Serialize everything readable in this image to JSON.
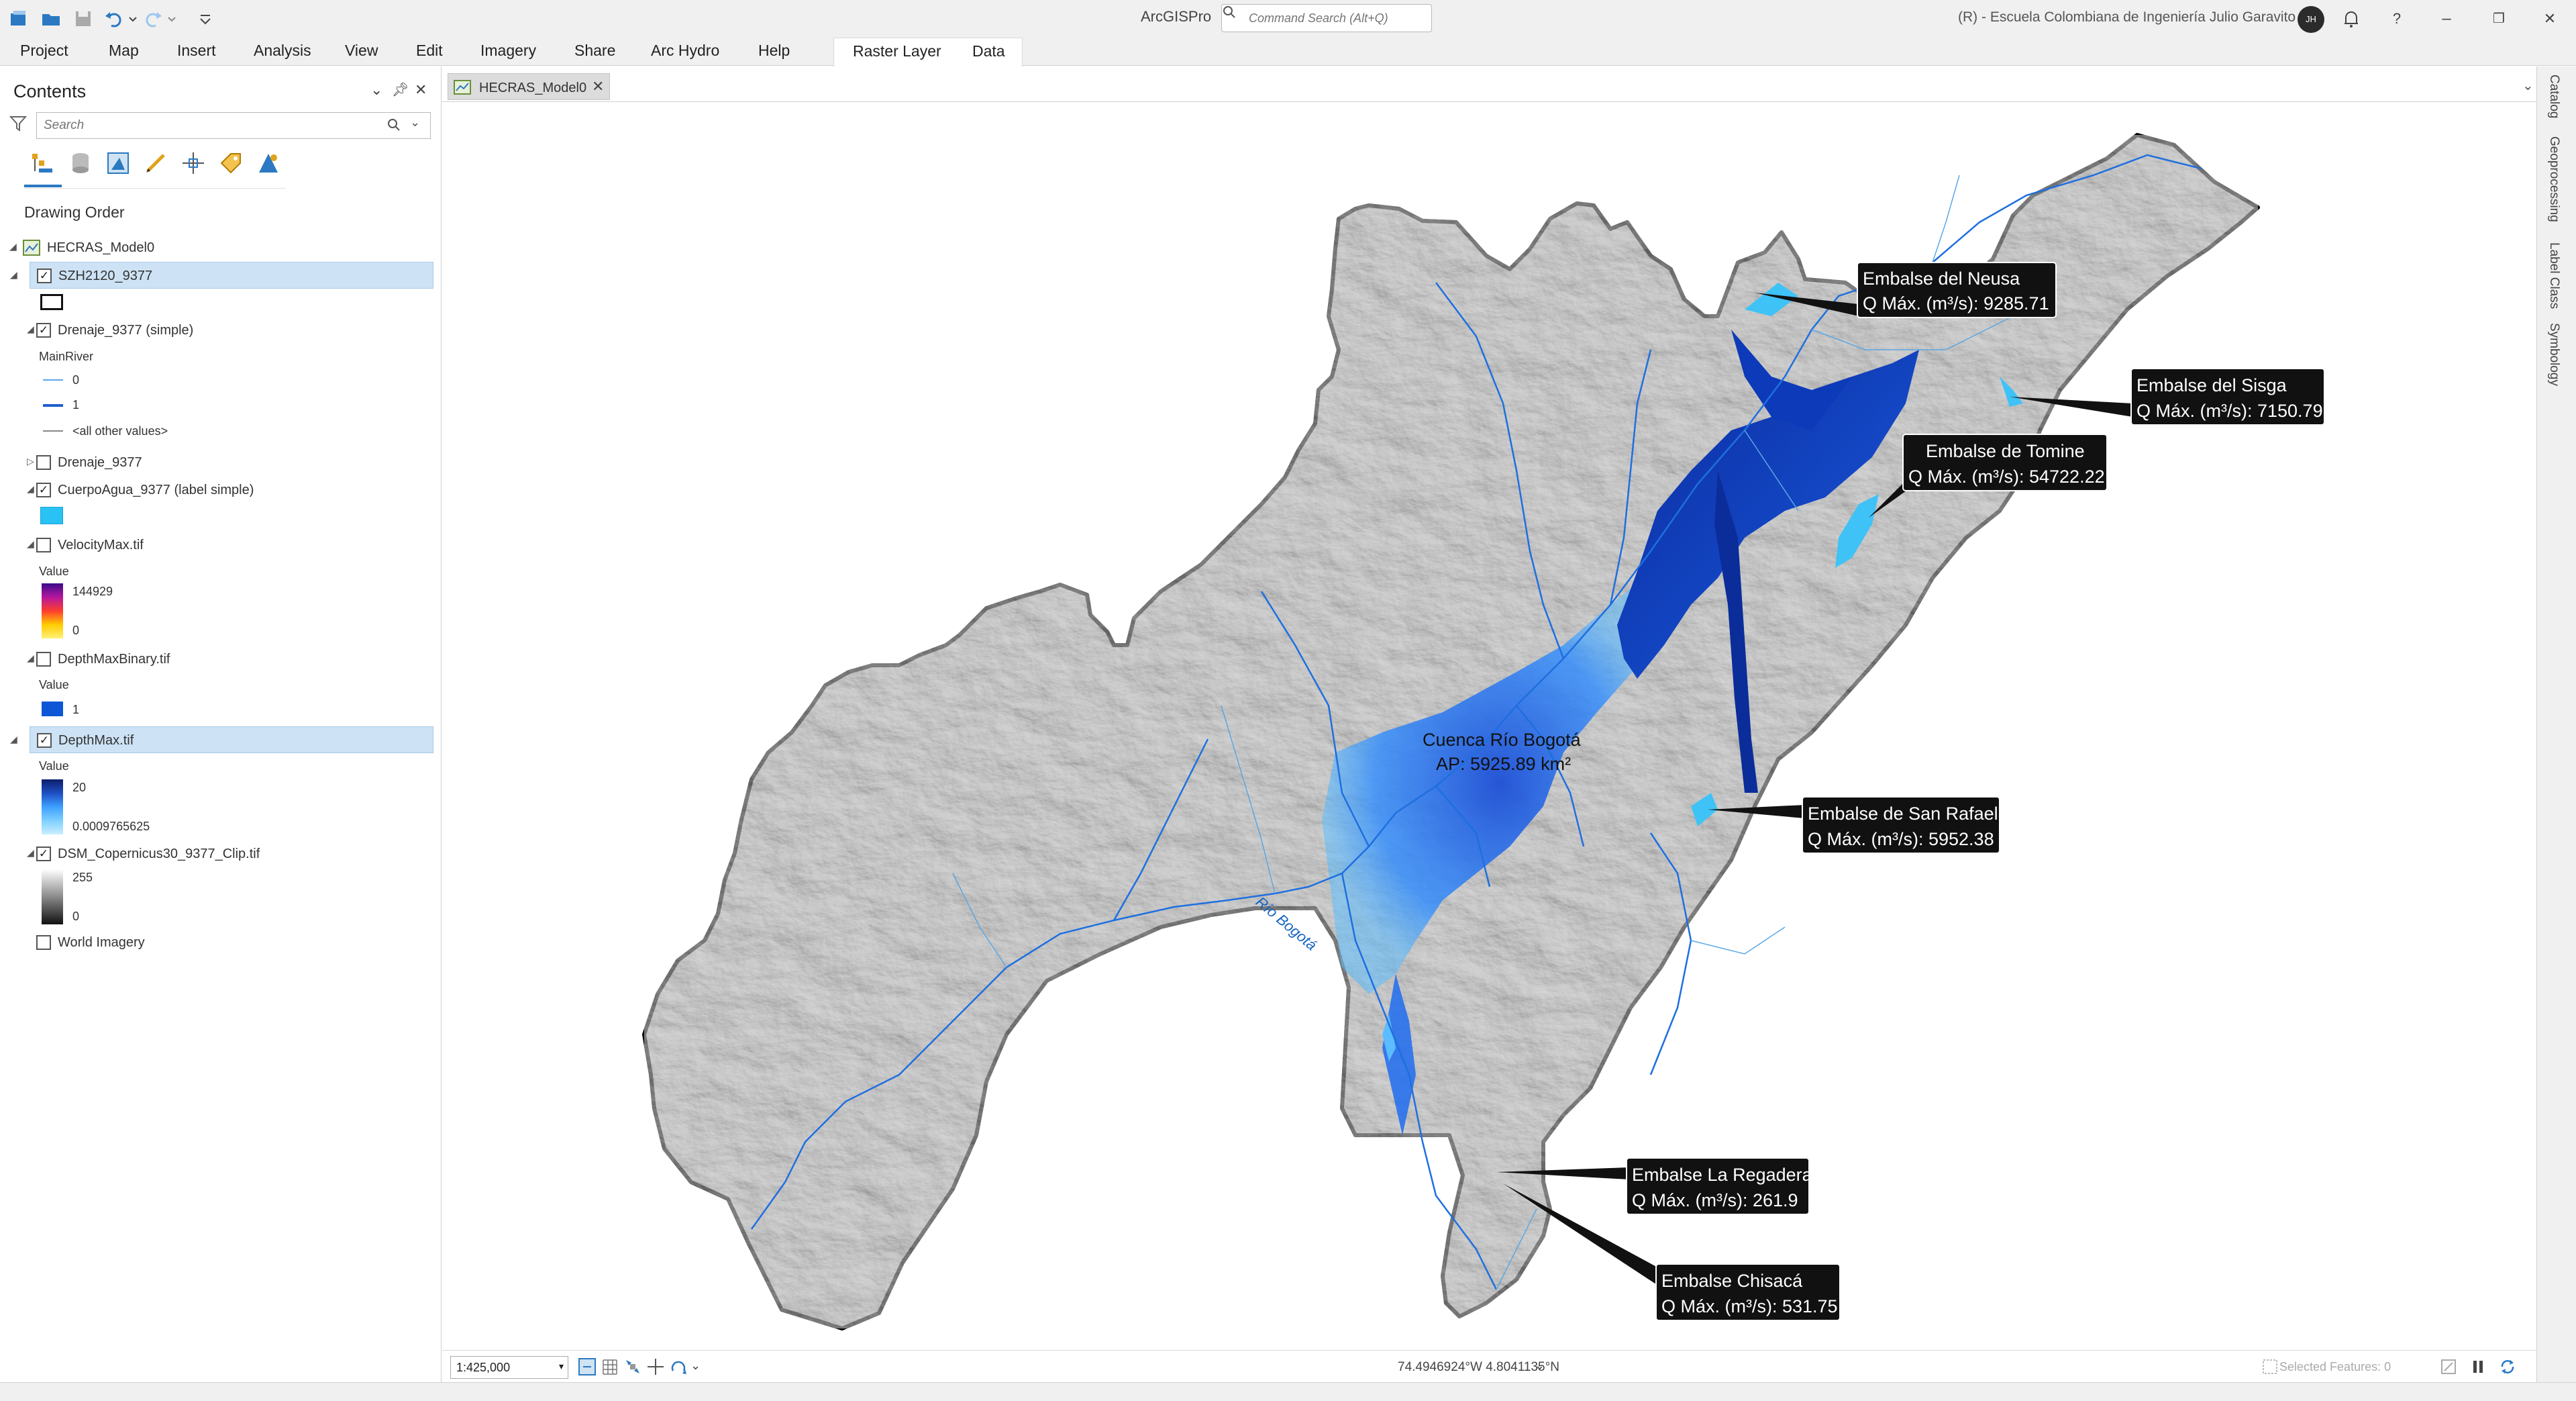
{
  "app": {
    "title": "ArcGISPro"
  },
  "search": {
    "placeholder": "Command Search (Alt+Q)"
  },
  "portal": {
    "user": "(R) - Escuela Colombiana de Ingeniería Julio Garavito",
    "avatar": "JH"
  },
  "ribbon": {
    "tabs": [
      "Project",
      "Map",
      "Insert",
      "Analysis",
      "View",
      "Edit",
      "Imagery",
      "Share",
      "Arc Hydro",
      "Help"
    ],
    "contextual": [
      "Raster Layer",
      "Data"
    ]
  },
  "contents": {
    "title": "Contents",
    "search_placeholder": "Search",
    "section": "Drawing Order",
    "map_name": "HECRAS_Model0",
    "layers": [
      {
        "name": "SZH2120_9377",
        "checked": true
      },
      {
        "name": "Drenaje_9377 (simple)",
        "checked": true
      },
      {
        "name": "Drenaje_9377",
        "checked": false
      },
      {
        "name": "CuerpoAgua_9377 (label simple)",
        "checked": true
      },
      {
        "name": "VelocityMax.tif",
        "checked": false
      },
      {
        "name": "DepthMaxBinary.tif",
        "checked": false
      },
      {
        "name": "DepthMax.tif",
        "checked": true
      },
      {
        "name": "DSM_Copernicus30_9377_Clip.tif",
        "checked": true
      },
      {
        "name": "World Imagery",
        "checked": false
      }
    ],
    "legend": {
      "drenaje_field": "MainRiver",
      "drenaje_classes": [
        "0",
        "1",
        "<all other values>"
      ],
      "value_label": "Value",
      "velocity": {
        "max": "144929",
        "min": "0"
      },
      "binary": {
        "value": "1"
      },
      "depth": {
        "max": "20",
        "min": "0.0009765625"
      },
      "dsm": {
        "max": "255",
        "min": "0"
      }
    }
  },
  "map": {
    "tab": "HECRAS_Model0",
    "basin_label": [
      "Cuenca Río Bogotá",
      "AP: 5925.89 km²"
    ],
    "river_label": "Río Bogotá",
    "callouts": [
      {
        "name": "Embalse del Neusa",
        "q": "Q Máx. (m³/s): 9285.71"
      },
      {
        "name": "Embalse del Sisga",
        "q": "Q Máx. (m³/s): 7150.79"
      },
      {
        "name": "Embalse de Tomine",
        "q": "Q Máx. (m³/s): 54722.22"
      },
      {
        "name": "Embalse de San Rafael",
        "q": "Q Máx. (m³/s): 5952.38"
      },
      {
        "name": "Embalse La Regadera",
        "q": "Q Máx. (m³/s): 261.9"
      },
      {
        "name": "Embalse Chisacá",
        "q": "Q Máx. (m³/s): 531.75"
      }
    ]
  },
  "status": {
    "scale": "1:425,000",
    "coords": "74.4946924°W 4.8041135°N",
    "selected": "Selected Features: 0"
  },
  "dock": [
    "Catalog",
    "Geoprocessing",
    "Label Class",
    "Symbology"
  ],
  "colors": {
    "accent": "#2b79c2",
    "water": "#29b6f6",
    "depth_dark": "#0d2a8a",
    "selection": "#cde3f5"
  }
}
